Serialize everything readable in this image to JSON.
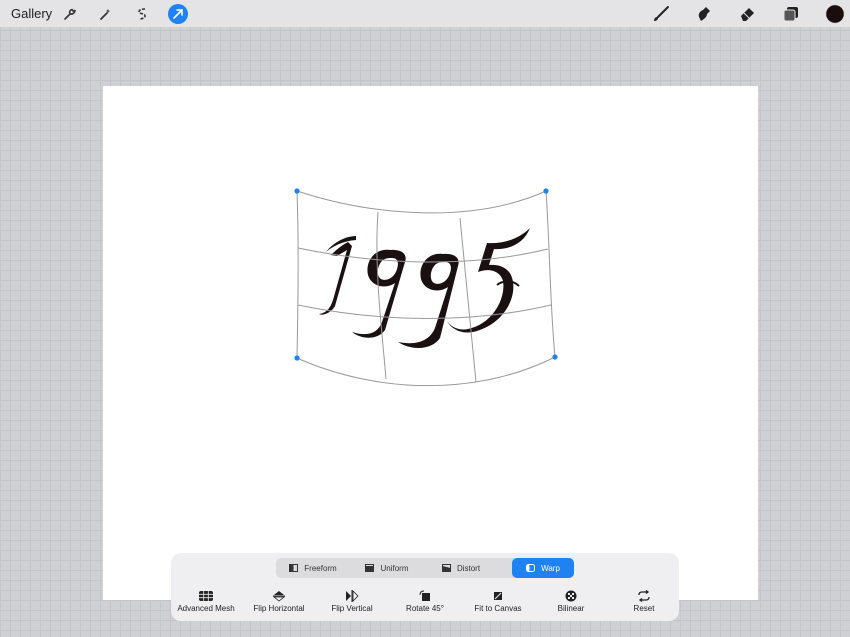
{
  "topbar": {
    "gallery_label": "Gallery",
    "left_tools": [
      "wrench-icon",
      "magic-wand-icon",
      "selection-icon",
      "transform-arrow-icon"
    ],
    "right_tools": [
      "brush-icon",
      "smudge-icon",
      "eraser-icon",
      "layers-icon",
      "color-swatch-icon"
    ],
    "active_tool": "transform-arrow-icon",
    "current_color": "#1a0d0d",
    "accent_color": "#1f82f2"
  },
  "canvas": {
    "artwork_text": "1995"
  },
  "transform_panel": {
    "modes": [
      {
        "label": "Freeform",
        "icon": "freeform-icon",
        "active": false
      },
      {
        "label": "Uniform",
        "icon": "uniform-icon",
        "active": false
      },
      {
        "label": "Distort",
        "icon": "distort-icon",
        "active": false
      },
      {
        "label": "Warp",
        "icon": "warp-icon",
        "active": true
      }
    ],
    "actions": [
      {
        "label": "Advanced Mesh",
        "icon": "mesh-icon"
      },
      {
        "label": "Flip Horizontal",
        "icon": "flip-horizontal-icon"
      },
      {
        "label": "Flip Vertical",
        "icon": "flip-vertical-icon"
      },
      {
        "label": "Rotate 45°",
        "icon": "rotate-icon"
      },
      {
        "label": "Fit to Canvas",
        "icon": "fit-canvas-icon"
      },
      {
        "label": "Bilinear",
        "icon": "bilinear-icon"
      },
      {
        "label": "Reset",
        "icon": "reset-icon"
      }
    ]
  }
}
